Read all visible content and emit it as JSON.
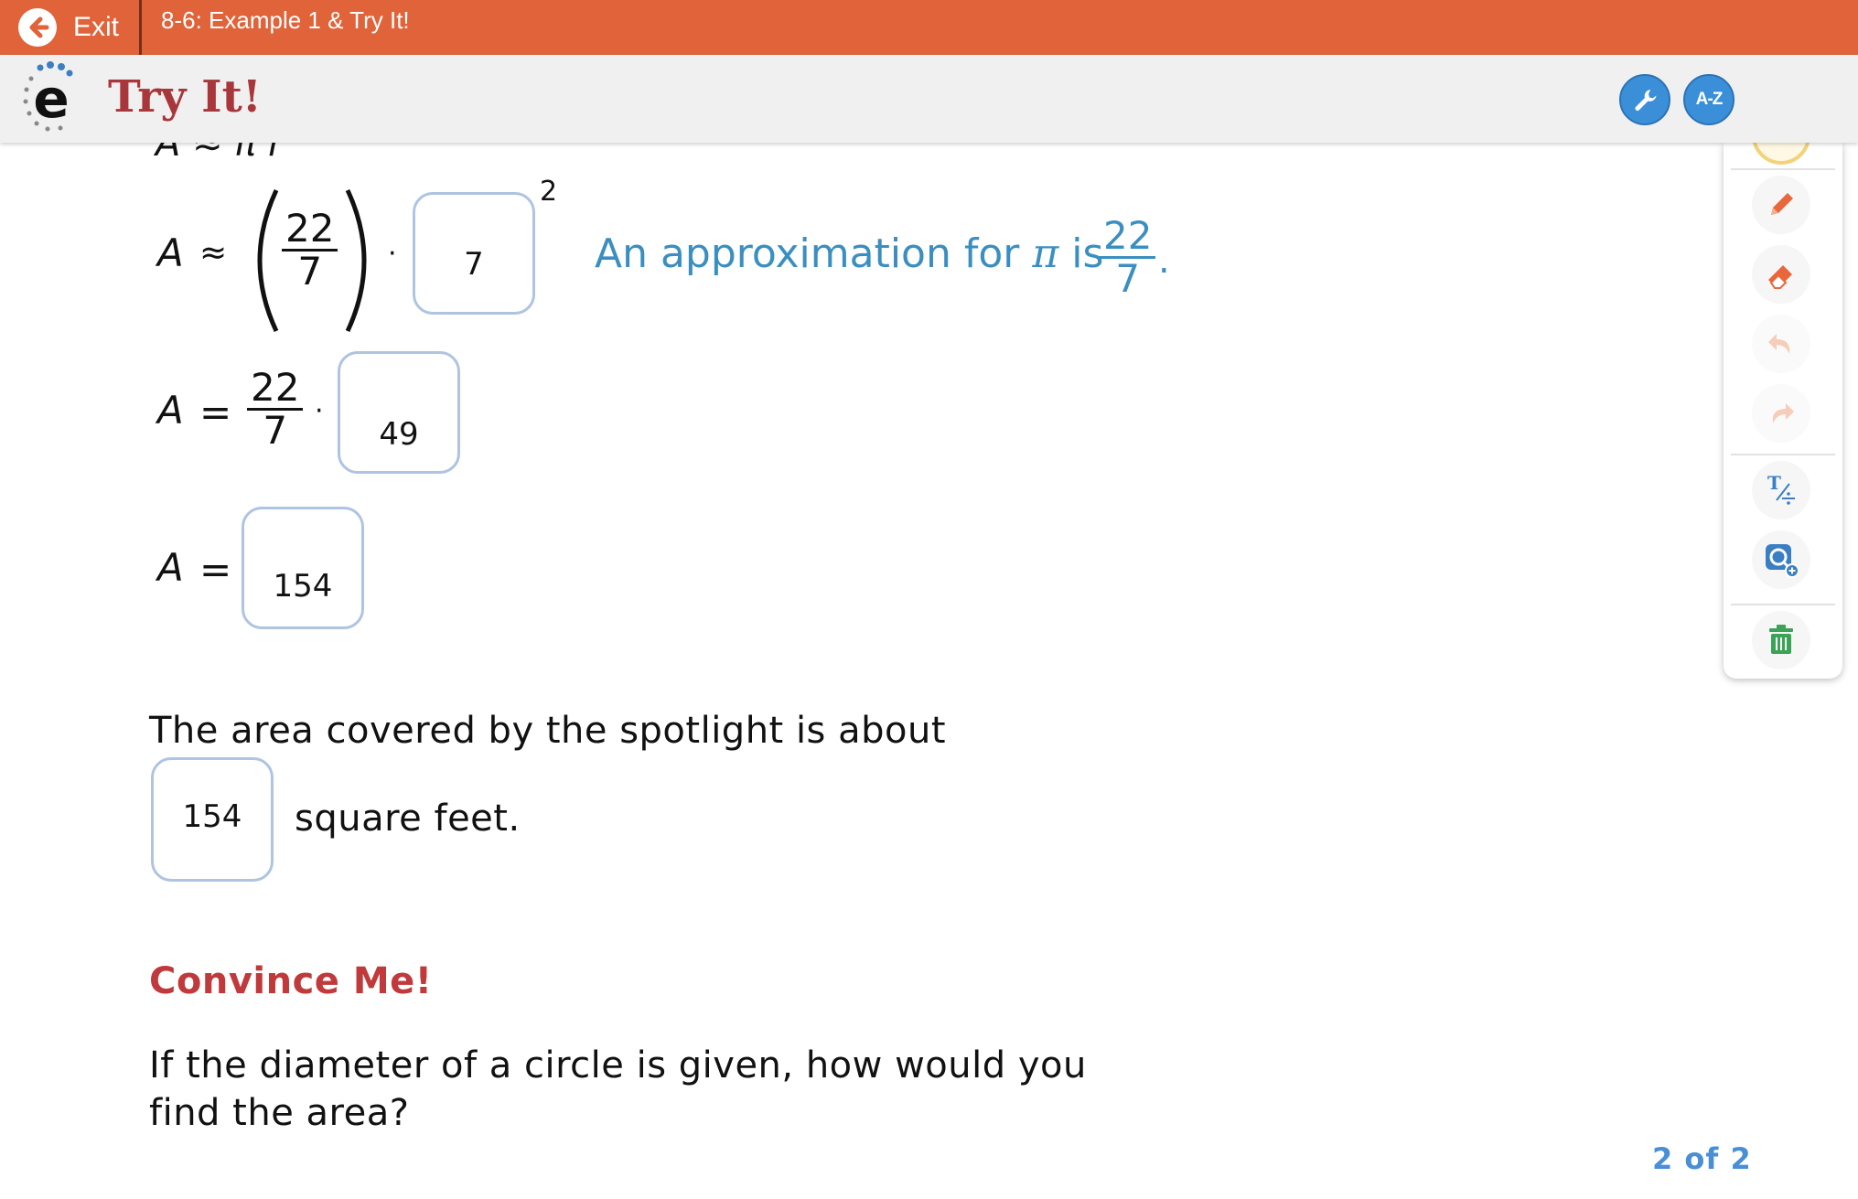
{
  "topbar": {
    "exit_label": "Exit",
    "lesson_title": "8-6: Example 1 & Try It!",
    "color": "#e0633a"
  },
  "header": {
    "logo_letter": "e",
    "title": "Try It!",
    "tools_button_icon": "wrench-icon",
    "glossary_label": "A-Z"
  },
  "equations": {
    "row1": {
      "var": "A",
      "relation": "≈",
      "frac_num": "22",
      "frac_den": "7",
      "dot": "·",
      "box_value": "7",
      "exponent": "2",
      "hint_text": "An approximation for",
      "hint_pi": "π",
      "hint_is": "is",
      "hint_frac_num": "22",
      "hint_frac_den": "7",
      "hint_period": "."
    },
    "row2": {
      "var": "A",
      "relation": "=",
      "frac_num": "22",
      "frac_den": "7",
      "dot": "·",
      "box_value": "49"
    },
    "row3": {
      "var": "A",
      "relation": "=",
      "box_value": "154"
    }
  },
  "answer": {
    "sentence": "The area covered by the spotlight is about",
    "box_value": "154",
    "unit_text": "square feet."
  },
  "convince": {
    "heading": "Convince Me!",
    "question_line1": "If the diameter of a circle is given, how would you",
    "question_line2": "find the area?",
    "heading_color": "#c0393b"
  },
  "pager": {
    "text": "2 of 2"
  },
  "tools": [
    {
      "icon": "highlighter-icon"
    },
    {
      "icon": "pencil-icon"
    },
    {
      "icon": "eraser-icon"
    },
    {
      "icon": "undo-icon"
    },
    {
      "icon": "redo-icon"
    },
    {
      "icon": "math-text-icon"
    },
    {
      "icon": "zoom-icon"
    },
    {
      "icon": "trash-icon"
    }
  ],
  "colors": {
    "hint_blue": "#3b8fc0",
    "box_border": "#aec4e0",
    "accent_blue": "#3a8fd8"
  }
}
